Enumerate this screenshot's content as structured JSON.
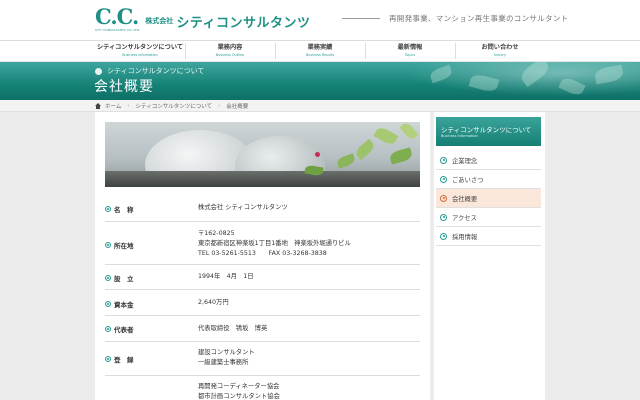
{
  "header": {
    "logo_mark": "C.C.",
    "logo_sub": "CITY CONSULTANTS CO.,LTD.",
    "company_prefix": "株式会社",
    "company_name": "シティコンサルタンツ",
    "tagline": "再開発事業、マンション再生事業のコンサルタント"
  },
  "nav": {
    "items": [
      {
        "label": "シティコンサルタンツについて",
        "sub": "Business information"
      },
      {
        "label": "業務内容",
        "sub": "Business Outline"
      },
      {
        "label": "業務実績",
        "sub": "Business Results"
      },
      {
        "label": "最新情報",
        "sub": "Topics"
      },
      {
        "label": "お問い合わせ",
        "sub": "Inquiry"
      }
    ]
  },
  "banner": {
    "subtitle": "シティコンサルタンツについて",
    "title": "会社概要"
  },
  "breadcrumb": {
    "items": [
      "ホーム",
      "シティコンサルタンツについて",
      "会社概要"
    ]
  },
  "company": {
    "rows": [
      {
        "label": "名　称",
        "lines": [
          "株式会社 シティコンサルタンツ"
        ]
      },
      {
        "label": "所在地",
        "lines": [
          "〒162-0825",
          "東京都新宿区神楽坂1丁目1番地　神楽坂外堀通りビル",
          "TEL 03-5261-5513　　FAX 03-3268-3838"
        ]
      },
      {
        "label": "設　立",
        "lines": [
          "1994年　4月　1日"
        ]
      },
      {
        "label": "資本金",
        "lines": [
          "2,640万円"
        ]
      },
      {
        "label": "代表者",
        "lines": [
          "代表取締役　鴇坂　博英"
        ]
      },
      {
        "label": "登　録",
        "lines": [
          "建設コンサルタント",
          "一級建築士事務所"
        ]
      },
      {
        "label": "",
        "lines": [
          "再開発コーディネーター協会",
          "都市計画コンサルタント協会"
        ]
      }
    ]
  },
  "sidebar": {
    "title": "シティコンサルタンツについて",
    "title_sub": "Business information",
    "items": [
      {
        "label": "企業理念"
      },
      {
        "label": "ごあいさつ"
      },
      {
        "label": "会社概要"
      },
      {
        "label": "アクセス"
      },
      {
        "label": "採用情報"
      }
    ]
  },
  "colors": {
    "brand": "#1d8f86",
    "banner": "#158277",
    "active_item_bg": "#fbe7d9",
    "active_icon": "#d16a36"
  }
}
